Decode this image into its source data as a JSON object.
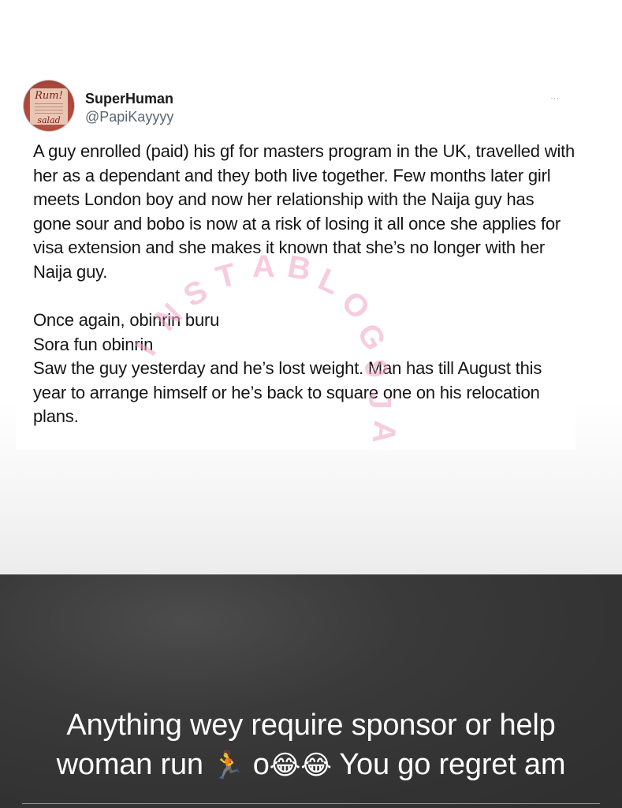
{
  "tweet": {
    "author": {
      "display_name": "SuperHuman",
      "handle": "@PapiKayyyy",
      "avatar_text_top": "Rum!",
      "avatar_text_bottom": "salad"
    },
    "more_icon": "⋯",
    "paragraph_1": "A guy enrolled (paid) his gf for masters program in the UK, travelled with her as a dependant and they both live together. Few months later girl meets London boy and now her relationship with the Naija guy has gone sour and bobo is now at a risk of losing it all once she applies for visa extension and she makes it known that she’s no longer with her Naija guy.",
    "line_1": "Once again, obinrin buru",
    "line_2": "Sora fun obinrin",
    "line_3": "Saw the guy yesterday and he’s lost weight. Man has till August this year to arrange himself or he’s back to square one on his relocation plans."
  },
  "watermark": {
    "text": "INSTABLOG9JA"
  },
  "story_caption": {
    "line_1": "Anything wey require sponsor or help",
    "line_2_before": "woman run",
    "running_emoji": "🏃",
    "line_2_middle": "o",
    "laughing_emoji_1": "😂",
    "laughing_emoji_2": "😂",
    "line_2_after": "You go regret am"
  }
}
